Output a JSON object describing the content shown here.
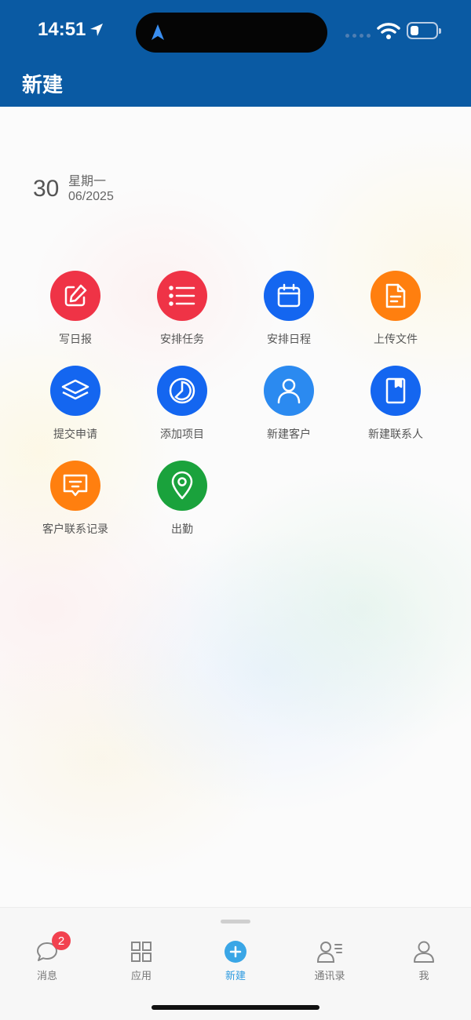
{
  "status_bar": {
    "time": "14:51"
  },
  "header": {
    "title": "新建"
  },
  "date": {
    "day": "30",
    "weekday": "星期一",
    "month_year": "06/2025"
  },
  "actions": [
    {
      "label": "写日报",
      "icon": "edit-icon",
      "color": "#ef3346"
    },
    {
      "label": "安排任务",
      "icon": "list-icon",
      "color": "#ef3346"
    },
    {
      "label": "安排日程",
      "icon": "calendar-icon",
      "color": "#1466f0"
    },
    {
      "label": "上传文件",
      "icon": "file-icon",
      "color": "#ff7f0f"
    },
    {
      "label": "提交申请",
      "icon": "layers-icon",
      "color": "#1466f0"
    },
    {
      "label": "添加项目",
      "icon": "pie-icon",
      "color": "#1466f0"
    },
    {
      "label": "新建客户",
      "icon": "user-icon",
      "color": "#2b8af0"
    },
    {
      "label": "新建联系人",
      "icon": "contact-book-icon",
      "color": "#1466f0"
    },
    {
      "label": "客户联系记录",
      "icon": "message-icon",
      "color": "#ff7f0f"
    },
    {
      "label": "出勤",
      "icon": "location-pin-icon",
      "color": "#1aa23c"
    }
  ],
  "tabbar": {
    "tabs": [
      {
        "label": "消息",
        "icon": "chat-bubble-icon",
        "badge": "2"
      },
      {
        "label": "应用",
        "icon": "grid-icon"
      },
      {
        "label": "新建",
        "icon": "plus-circle-icon",
        "active": true
      },
      {
        "label": "通讯录",
        "icon": "contacts-icon"
      },
      {
        "label": "我",
        "icon": "person-icon"
      }
    ]
  },
  "colors": {
    "header": "#0a5aa3",
    "active_tab": "#2e9be0",
    "badge": "#f2414f"
  }
}
